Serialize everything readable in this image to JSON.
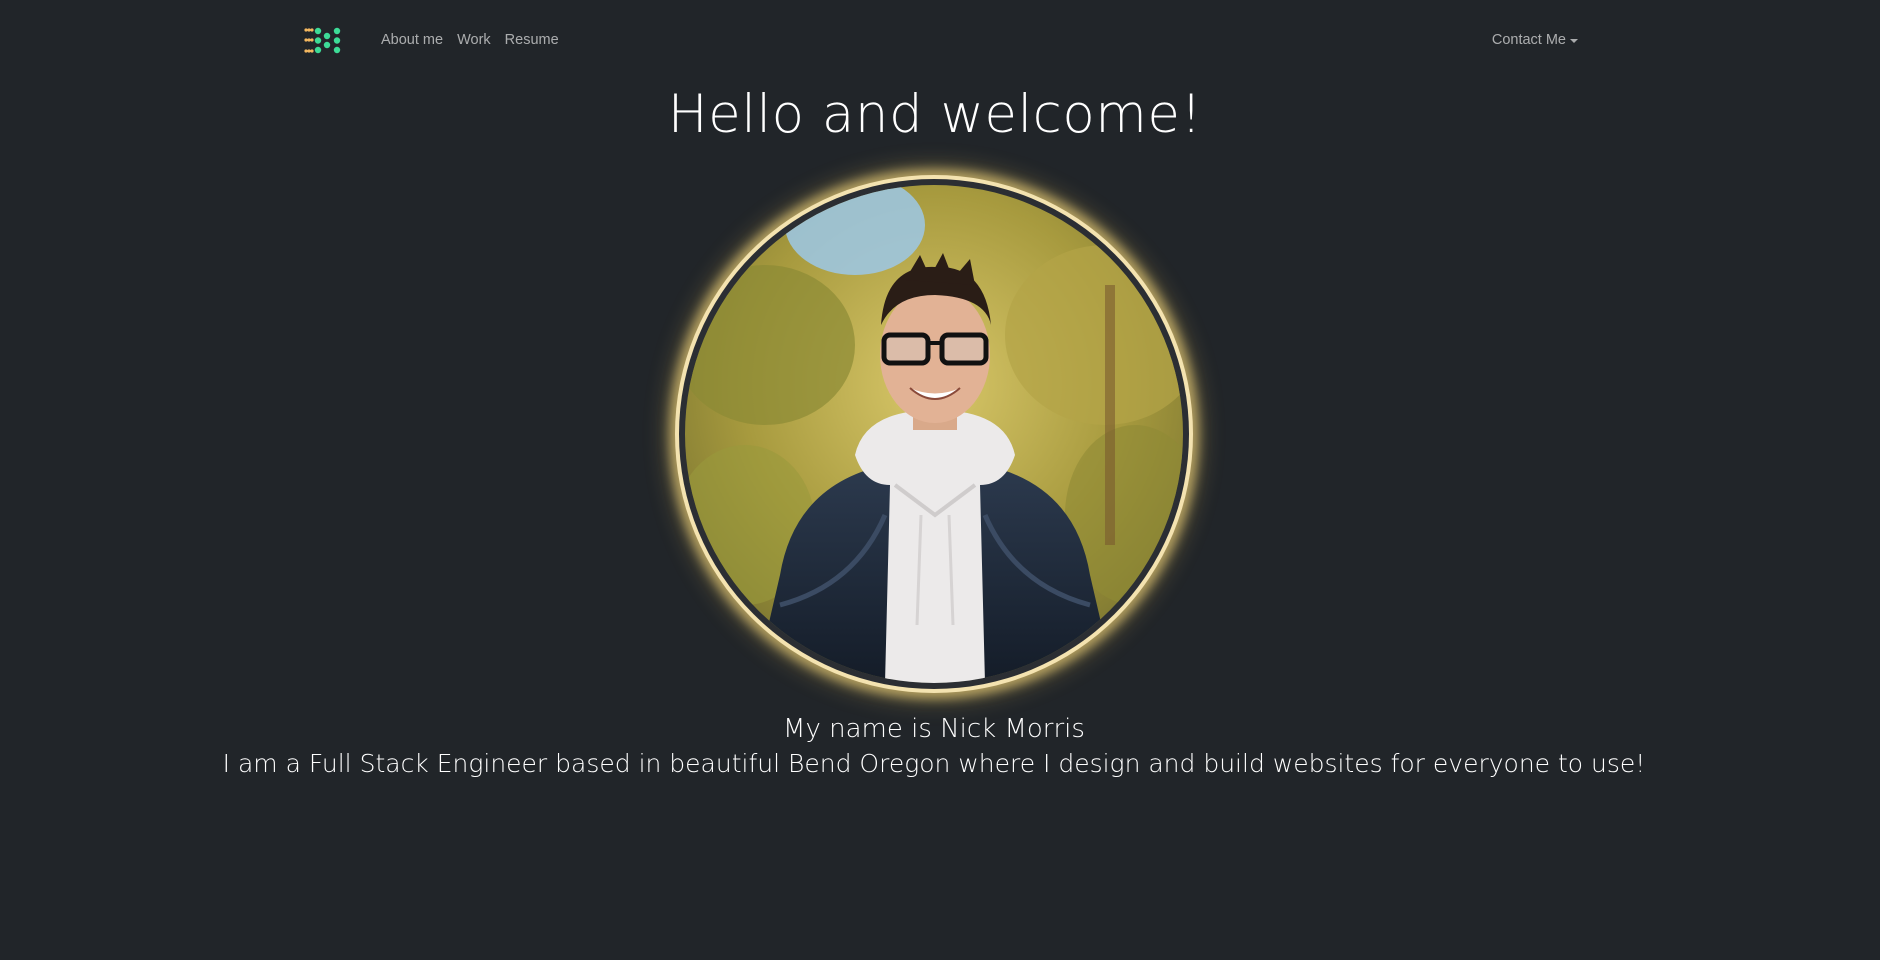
{
  "navbar": {
    "logo_icon": "dotted-n-logo-icon",
    "links": [
      {
        "label": "About me"
      },
      {
        "label": "Work"
      },
      {
        "label": "Resume"
      }
    ],
    "contact_label": "Contact Me",
    "contact_icon": "caret-down-icon"
  },
  "hero": {
    "title": "Hello and welcome!",
    "portrait_alt": "portrait-photo",
    "glow_color": "#ffe082"
  },
  "intro": {
    "name_line": "My name is Nick Morris",
    "description": "I am a Full Stack Engineer based in beautiful Bend Oregon where I design and build websites for everyone to use!"
  },
  "colors": {
    "background": "#212529",
    "logo_green": "#3ddc97",
    "logo_orange": "#f4b860"
  }
}
